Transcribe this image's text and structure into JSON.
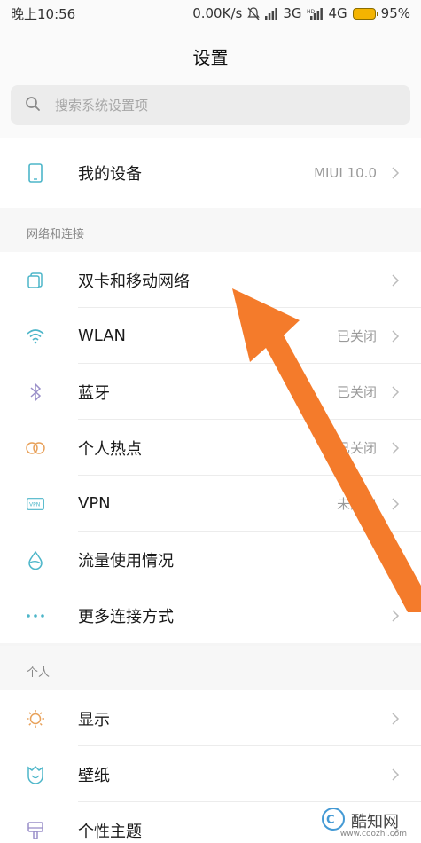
{
  "status_bar": {
    "time": "晚上10:56",
    "speed": "0.00K/s",
    "net1": "3G",
    "net2": "4G",
    "battery": "95%"
  },
  "header": {
    "title": "设置"
  },
  "search": {
    "placeholder": "搜索系统设置项"
  },
  "device": {
    "label": "我的设备",
    "value": "MIUI 10.0"
  },
  "network": {
    "section_title": "网络和连接",
    "items": [
      {
        "label": "双卡和移动网络",
        "value": "",
        "icon": "sim-card-icon"
      },
      {
        "label": "WLAN",
        "value": "已关闭",
        "icon": "wifi-icon"
      },
      {
        "label": "蓝牙",
        "value": "已关闭",
        "icon": "bluetooth-icon"
      },
      {
        "label": "个人热点",
        "value": "已关闭",
        "icon": "hotspot-icon"
      },
      {
        "label": "VPN",
        "value": "未开启",
        "icon": "vpn-icon"
      },
      {
        "label": "流量使用情况",
        "value": "",
        "icon": "data-usage-icon"
      },
      {
        "label": "更多连接方式",
        "value": "",
        "icon": "more-connections-icon"
      }
    ]
  },
  "personal": {
    "section_title": "个人",
    "items": [
      {
        "label": "显示",
        "icon": "display-icon"
      },
      {
        "label": "壁纸",
        "icon": "wallpaper-icon"
      },
      {
        "label": "个性主题",
        "icon": "theme-icon"
      }
    ]
  },
  "watermark": {
    "name": "酷知网",
    "url": "www.coozhi.com"
  },
  "colors": {
    "accent_arrow": "#f47b2b",
    "icon_teal": "#4db6c9",
    "icon_orange": "#e8a15a",
    "icon_purple": "#9a8fc9",
    "value_gray": "#9a9a9a"
  }
}
